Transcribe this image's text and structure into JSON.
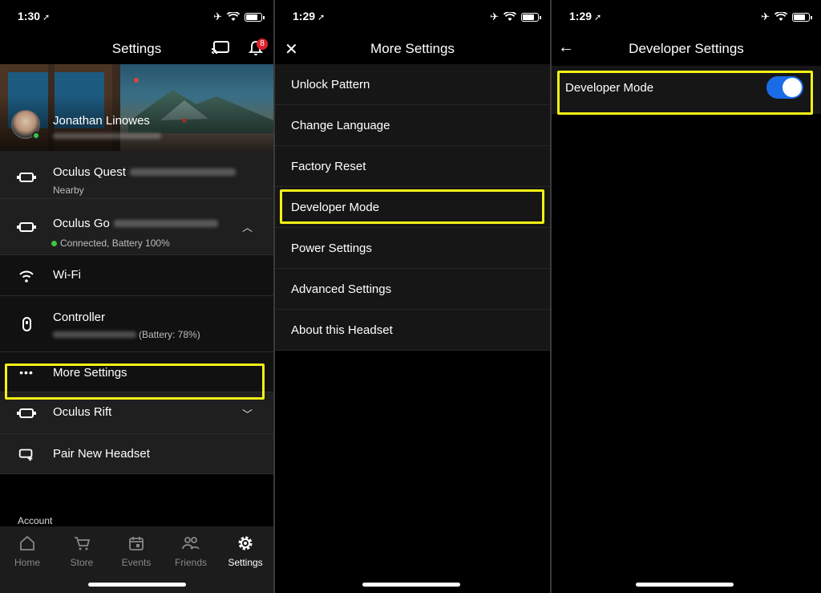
{
  "panel1": {
    "status": {
      "time": "1:30"
    },
    "title": "Settings",
    "notification_count": "8",
    "profile": {
      "name": "Jonathan Linowes"
    },
    "devices": [
      {
        "name": "Oculus Quest",
        "status": "Nearby"
      },
      {
        "name": "Oculus Go",
        "status": "Connected, Battery 100%"
      }
    ],
    "go_items": [
      {
        "label": "Wi-Fi"
      },
      {
        "label": "Controller",
        "sub": "(Battery: 78%)"
      },
      {
        "label": "More Settings"
      }
    ],
    "rift": {
      "name": "Oculus Rift"
    },
    "pair": {
      "label": "Pair New Headset"
    },
    "section": "Account",
    "tabs": [
      {
        "label": "Home",
        "icon": "home-icon"
      },
      {
        "label": "Store",
        "icon": "cart-icon"
      },
      {
        "label": "Events",
        "icon": "calendar-icon"
      },
      {
        "label": "Friends",
        "icon": "friends-icon"
      },
      {
        "label": "Settings",
        "icon": "gear-icon",
        "active": true
      }
    ]
  },
  "panel2": {
    "status": {
      "time": "1:29"
    },
    "title": "More Settings",
    "items": [
      "Unlock Pattern",
      "Change Language",
      "Factory Reset",
      "Developer Mode",
      "Power Settings",
      "Advanced Settings",
      "About this Headset"
    ]
  },
  "panel3": {
    "status": {
      "time": "1:29"
    },
    "title": "Developer Settings",
    "developer_mode": {
      "label": "Developer Mode",
      "enabled": true
    }
  },
  "colors": {
    "highlight": "#f2f216",
    "toggle_on": "#1a6be6",
    "online": "#3ec343",
    "badge": "#e0212a"
  }
}
